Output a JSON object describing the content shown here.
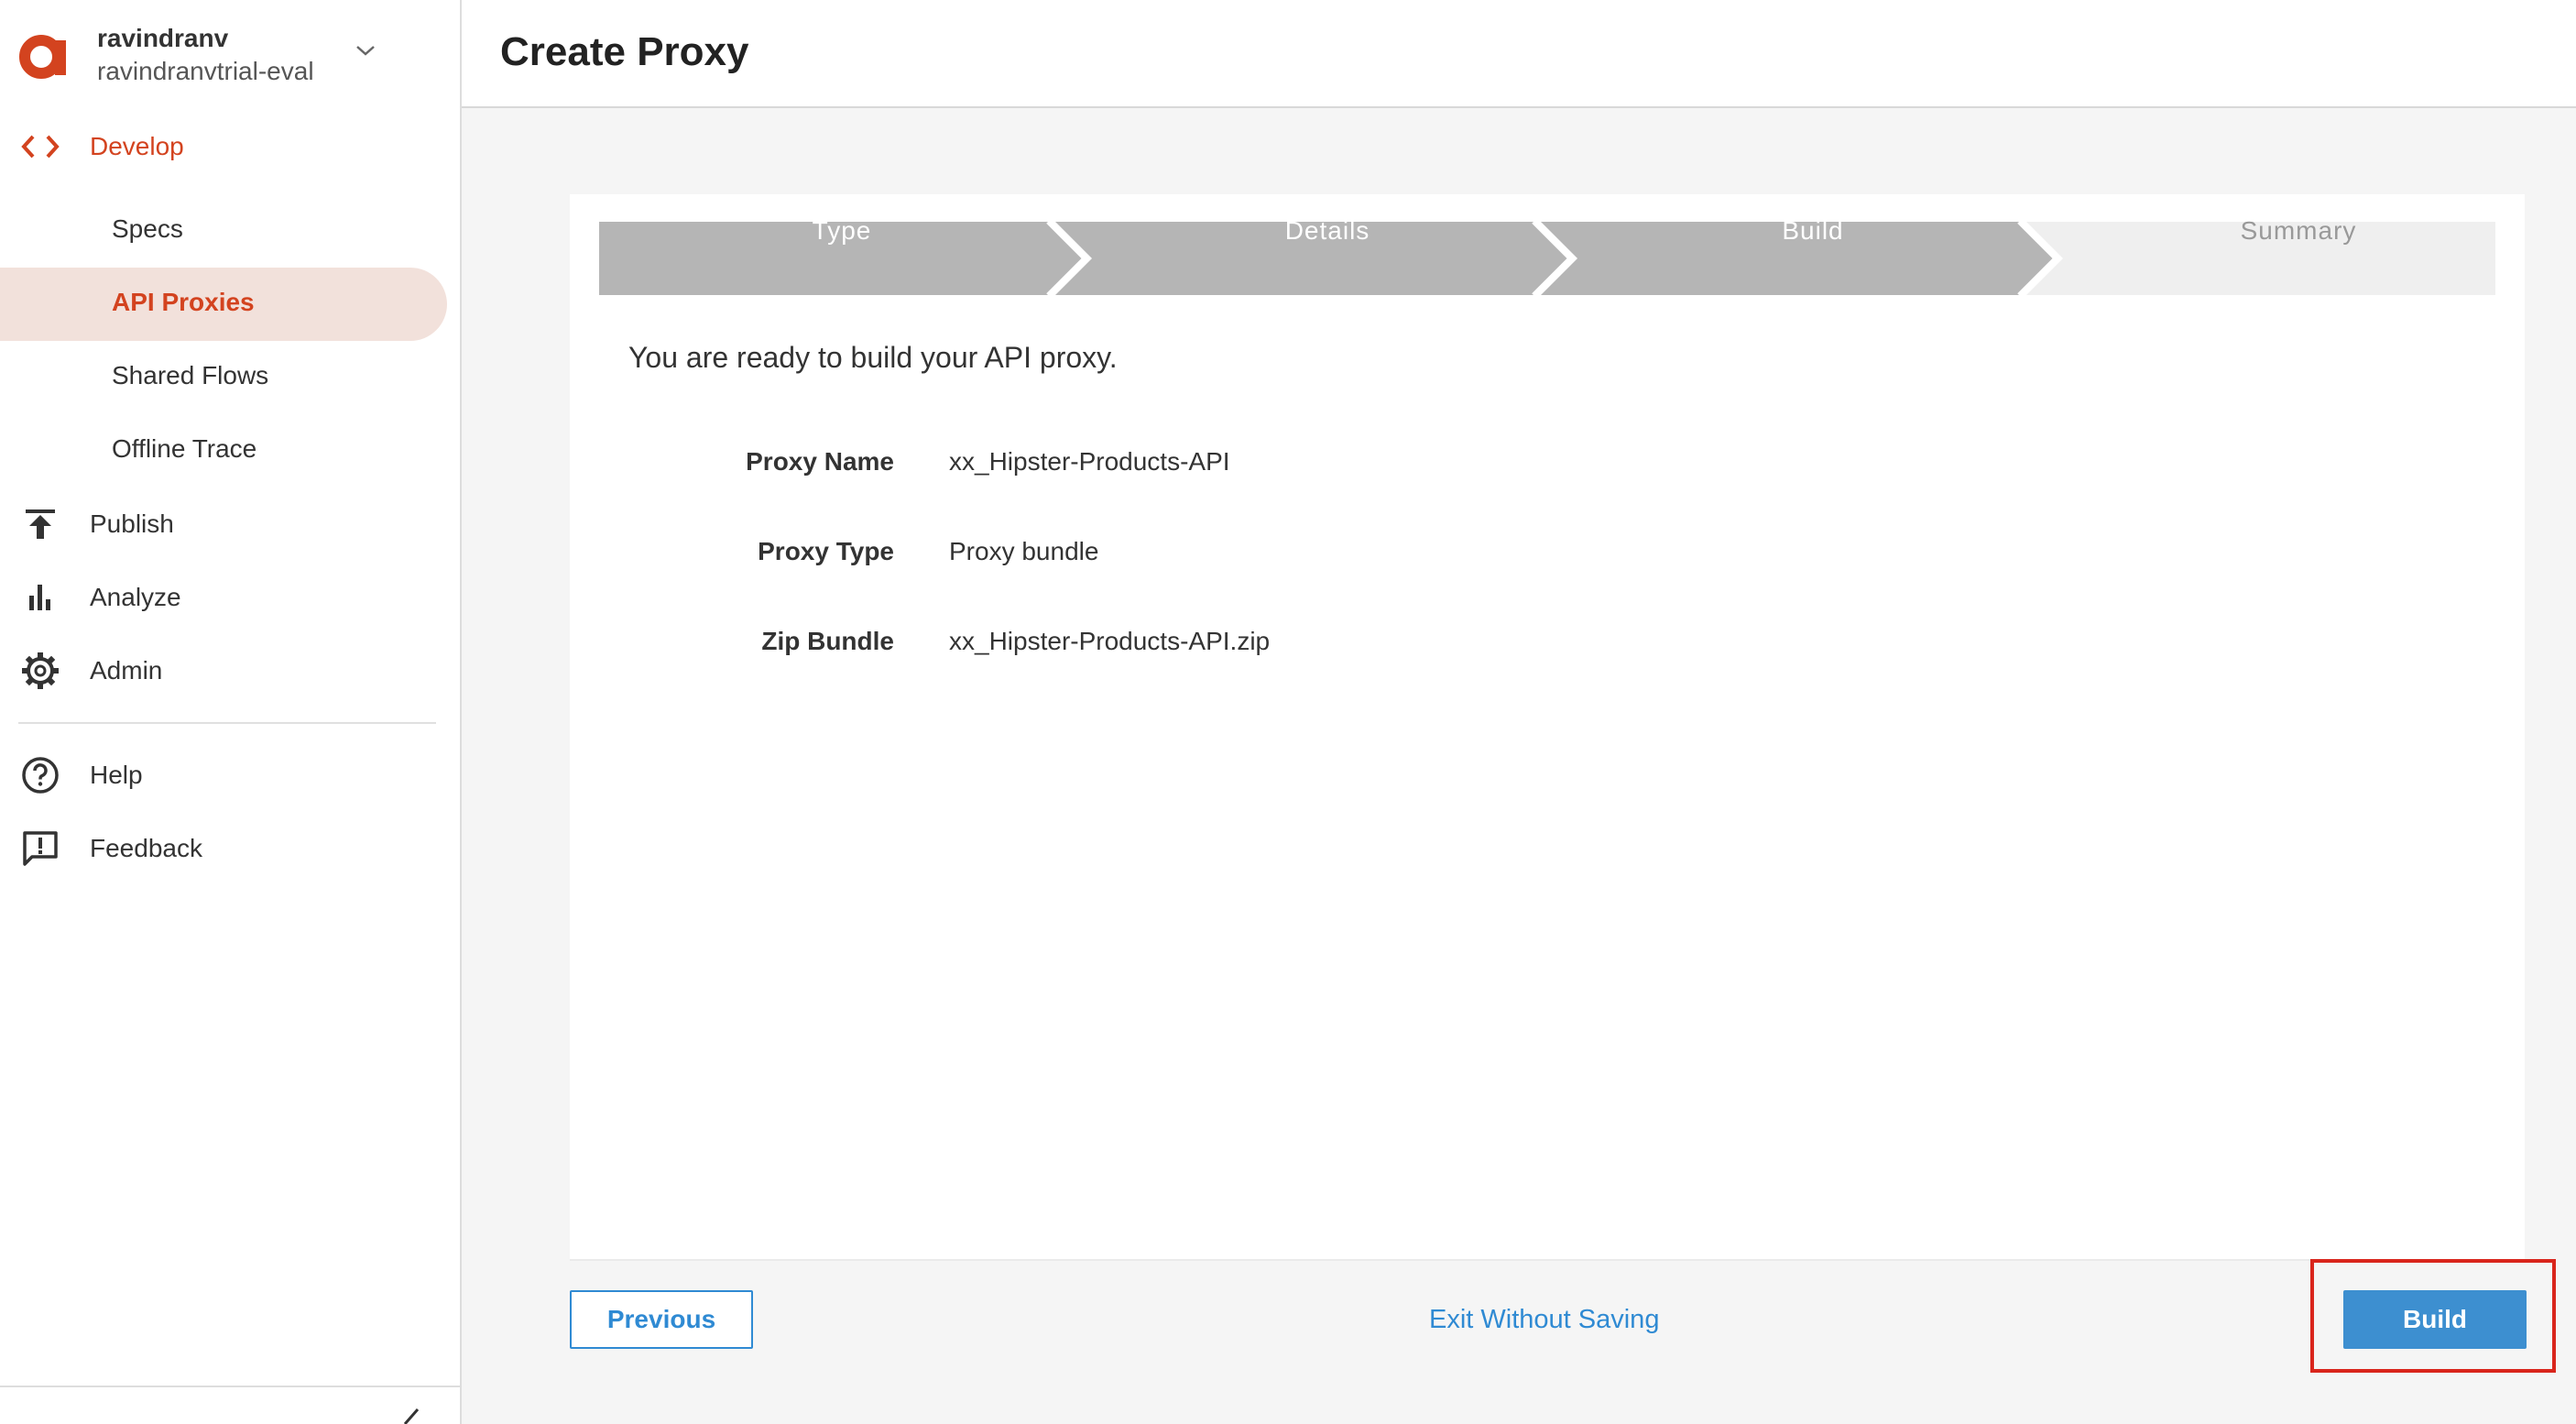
{
  "account": {
    "user": "ravindranv",
    "org": "ravindranvtrial-eval",
    "logo_icon": "apigee-logo-icon",
    "menu_icon": "chevron-down-icon"
  },
  "nav": {
    "develop": {
      "label": "Develop",
      "icon": "code-brackets-icon"
    },
    "sub_items": [
      {
        "label": "Specs"
      },
      {
        "label": "API Proxies",
        "active": true
      },
      {
        "label": "Shared Flows"
      },
      {
        "label": "Offline Trace"
      }
    ],
    "publish": {
      "label": "Publish",
      "icon": "publish-upload-icon"
    },
    "analyze": {
      "label": "Analyze",
      "icon": "bar-chart-icon"
    },
    "admin": {
      "label": "Admin",
      "icon": "gear-icon"
    },
    "help": {
      "label": "Help",
      "icon": "help-circle-icon"
    },
    "feedback": {
      "label": "Feedback",
      "icon": "feedback-icon"
    }
  },
  "header": {
    "title": "Create Proxy"
  },
  "wizard": {
    "steps": [
      {
        "label": "Type",
        "state": "done"
      },
      {
        "label": "Details",
        "state": "done"
      },
      {
        "label": "Build",
        "state": "current"
      },
      {
        "label": "Summary",
        "state": "pending"
      }
    ],
    "ready_text": "You are ready to build your API proxy.",
    "fields": [
      {
        "label": "Proxy Name",
        "value": "xx_Hipster-Products-API"
      },
      {
        "label": "Proxy Type",
        "value": "Proxy bundle"
      },
      {
        "label": "Zip Bundle",
        "value": "xx_Hipster-Products-API.zip"
      }
    ]
  },
  "footer": {
    "previous_label": "Previous",
    "exit_label": "Exit Without Saving",
    "build_label": "Build"
  },
  "colors": {
    "accent": "#d3431f",
    "active_bg": "#f2e1db",
    "link": "#2f8ad3",
    "primary_button": "#3d8fd0",
    "step_done": "#b5b5b5",
    "step_pending": "#efefef",
    "highlight": "#d9251c"
  }
}
